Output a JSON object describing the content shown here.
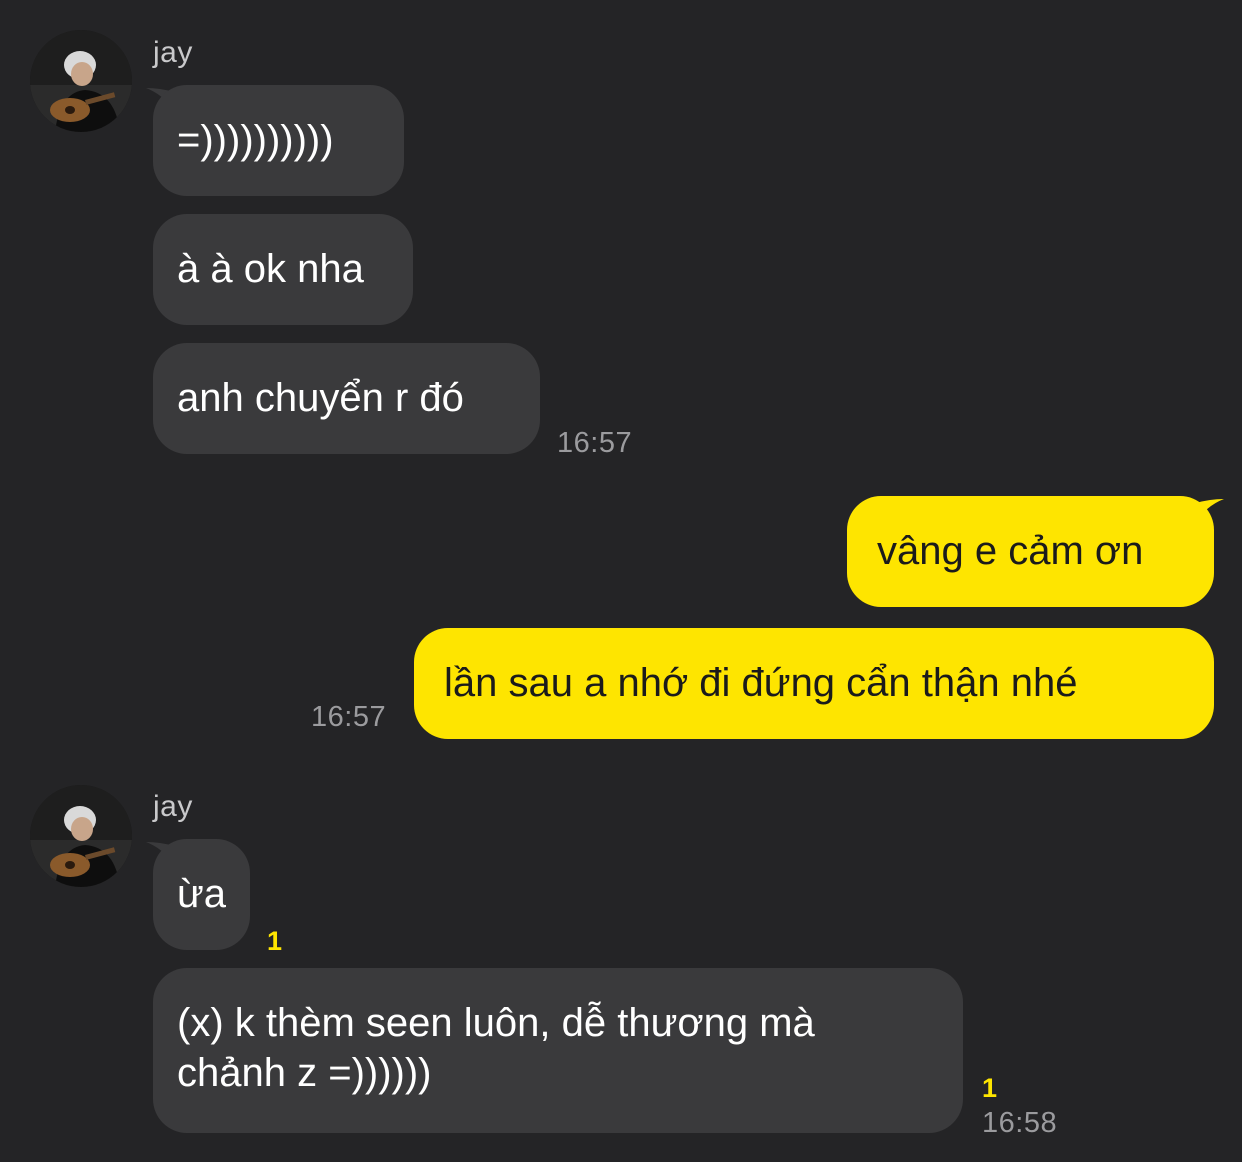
{
  "colors": {
    "background": "#242426",
    "incoming_bubble": "#3a3a3c",
    "outgoing_bubble": "#fee500",
    "unread_badge": "#fee500",
    "timestamp": "#9b9b9e"
  },
  "groups": [
    {
      "sender": "jay",
      "messages": [
        {
          "text": "=))))))))))"
        },
        {
          "text": "à à ok nha"
        },
        {
          "text": "anh chuyển r đó",
          "time": "16:57"
        }
      ]
    },
    {
      "sender": "me",
      "messages": [
        {
          "text": "vâng e cảm ơn"
        },
        {
          "text": "lần sau a nhớ đi đứng cẩn thận nhé",
          "time": "16:57"
        }
      ]
    },
    {
      "sender": "jay",
      "messages": [
        {
          "text": "ừa",
          "unread": "1"
        },
        {
          "text": "(x) k thèm seen luôn, dễ thương mà chảnh z =))))))",
          "unread": "1",
          "time": "16:58"
        }
      ]
    }
  ]
}
